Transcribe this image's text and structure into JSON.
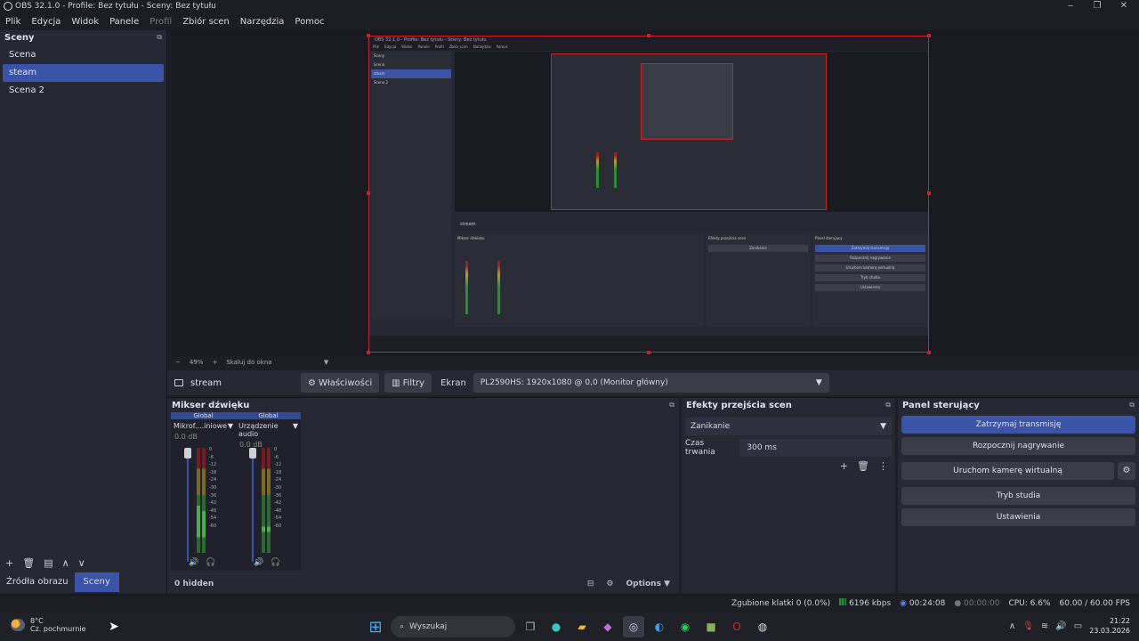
{
  "window": {
    "title": "OBS 32.1.0 - Profile: Bez tytułu - Sceny: Bez tytułu"
  },
  "menu": [
    "Plik",
    "Edycja",
    "Widok",
    "Panele",
    "Profil",
    "Zbiór scen",
    "Narzędzia",
    "Pomoc"
  ],
  "scenes": {
    "title": "Sceny",
    "items": [
      "Scena",
      "steam",
      "Scena 2"
    ],
    "selected": "steam",
    "tabs": [
      "Źródła obrazu",
      "Sceny"
    ]
  },
  "preview": {
    "zoom": "49%",
    "scale_mode": "Skaluj do okna",
    "mini_title": "OBS 32.1.0 - Profile: Bez tytułu - Sceny: Bez tytułu",
    "mini_menu": [
      "Plik",
      "Edycja",
      "Widok",
      "Panele",
      "Profil",
      "Zbiór scen",
      "Narzędzia",
      "Pomoc"
    ],
    "mini_scenes": [
      "Scena",
      "steam",
      "Scena 2"
    ]
  },
  "source_bar": {
    "name": "stream",
    "properties_label": "Właściwości",
    "filters_label": "Filtry",
    "display_label": "Ekran",
    "display_value": "PL2590HS: 1920x1080 @ 0,0 (Monitor główny)"
  },
  "mixer": {
    "title": "Mikser dźwięku",
    "channels": [
      {
        "header": "Global",
        "name": "Mikrof....iniowe",
        "db": "0.0 dB"
      },
      {
        "header": "Global",
        "name": "Urządzenie audio",
        "db": "0.0 dB"
      }
    ],
    "ticks": [
      "0",
      "-6",
      "-12",
      "-18",
      "-24",
      "-30",
      "-36",
      "-42",
      "-48",
      "-54",
      "-60"
    ],
    "hidden_label": "0 hidden",
    "options_label": "Options"
  },
  "transitions": {
    "title": "Efekty przejścia scen",
    "selected": "Zanikanie",
    "duration_label": "Czas trwania",
    "duration_value": "300 ms"
  },
  "controls": {
    "title": "Panel sterujący",
    "buttons": [
      "Zatrzymaj transmisję",
      "Rozpocznij nagrywanie",
      "Uruchom kamerę wirtualną",
      "Tryb studia",
      "Ustawienia"
    ]
  },
  "status": {
    "dropped": "Zgubione klatki 0 (0.0%)",
    "bitrate": "6196 kbps",
    "stream_time": "00:24:08",
    "rec_time": "00:00:00",
    "cpu": "CPU: 6.6%",
    "fps": "60.00 / 60.00 FPS"
  },
  "taskbar": {
    "temp": "8°C",
    "weather": "Cz. pochmurnie",
    "search": "Wyszukaj",
    "time": "21:22",
    "date": "23.03.2026"
  }
}
